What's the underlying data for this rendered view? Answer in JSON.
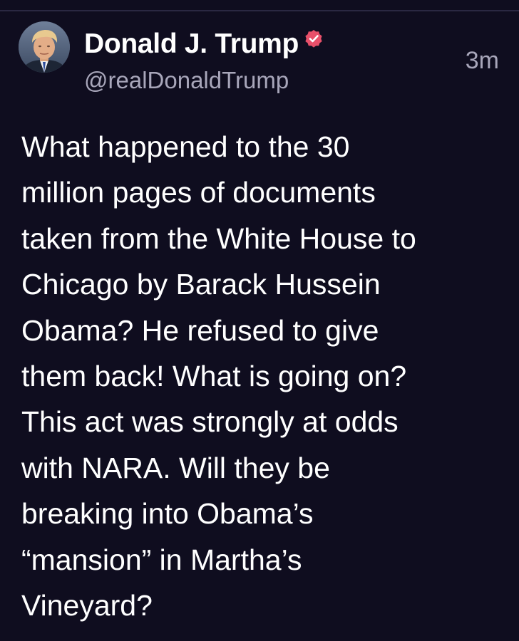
{
  "post": {
    "author": {
      "display_name": "Donald J. Trump",
      "handle": "@realDonaldTrump",
      "verified": true,
      "avatar_icon": "profile-photo-avatar",
      "badge_icon": "verified-check-icon",
      "badge_color": "#e8506a"
    },
    "timestamp": "3m",
    "body_lines": [
      "What happened to the 30",
      "million pages of documents",
      "taken from the White House to",
      "Chicago by Barack Hussein",
      "Obama? He refused to give",
      "them back! What is going on?",
      "This act was strongly at odds",
      "with NARA. Will they be",
      "breaking into Obama’s",
      "“mansion” in Martha’s",
      "Vineyard?"
    ]
  },
  "theme": {
    "background": "#0f0d1f",
    "text_primary": "#ffffff",
    "text_secondary": "#a8a6ba",
    "divider": "#2a2842"
  }
}
